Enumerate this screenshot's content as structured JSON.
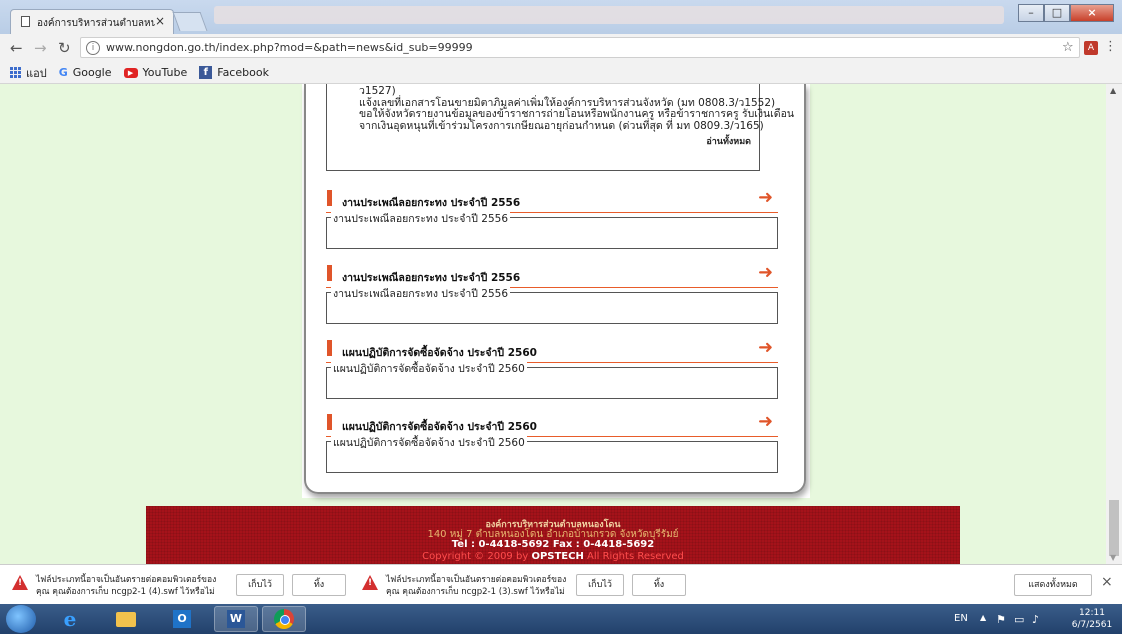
{
  "browser": {
    "tab_title": "องค์การบริหารส่วนตำบลหนอ",
    "tab_close": "×",
    "url": "www.nongdon.go.th/index.php?mod=&path=news&id_sub=99999",
    "window_buttons": [
      "–",
      "□",
      "×"
    ]
  },
  "bookmarks": [
    {
      "label": "แอป",
      "icon": "apps-icon"
    },
    {
      "label": "Google",
      "icon": "google-icon"
    },
    {
      "label": "YouTube",
      "icon": "youtube-icon"
    },
    {
      "label": "Facebook",
      "icon": "facebook-icon"
    }
  ],
  "top_list": {
    "lines": [
      "ว1527)",
      "แจ้งเลขที่เอกสารโอนขายมิตาภิมูลค่าเพิ่มให้องค์การบริหารส่วนจังหวัด (มท 0808.3/ว1552)",
      "ขอให้จังหวัดรายงานข้อมูลของข้าราชการถ่ายโอนหรือพนักงานครู หรือข้าราชการครู รับเงินเดือน",
      "จากเงินอุดหนุนที่เข้าร่วมโครงการเกษียณอายุก่อนกำหนด (ด่วนที่สุด ที่ มท 0809.3/ว165)"
    ],
    "read_all": "อ่านทั้งหมด"
  },
  "sections": [
    {
      "title": "งานประเพณีลอยกระทง ประจำปี 2556",
      "legend": "งานประเพณีลอยกระทง ประจำปี 2556"
    },
    {
      "title": "งานประเพณีลอยกระทง ประจำปี 2556",
      "legend": "งานประเพณีลอยกระทง ประจำปี 2556"
    },
    {
      "title": "แผนปฏิบัติการจัดซื้อจัดจ้าง ประจำปี 2560",
      "legend": "แผนปฏิบัติการจัดซื้อจัดจ้าง ประจำปี 2560"
    },
    {
      "title": "แผนปฏิบัติการจัดซื้อจัดจ้าง ประจำปี 2560",
      "legend": "แผนปฏิบัติการจัดซื้อจัดจ้าง ประจำปี 2560"
    }
  ],
  "footer": {
    "org_name": "องค์การบริหารส่วนตำบลหนองโดน",
    "address": "140 หมู่ 7 ตำบลหนองโดน อำเภอบ้านกรวด จังหวัดบุรีรัมย์",
    "phone_line": "Tel : 0-4418-5692  Fax : 0-4418-5692",
    "copyright_prefix": "Copyright © 2009 by",
    "copyright_company": "OPSTECH",
    "copyright_suffix": "All Rights Reserved"
  },
  "downloads": {
    "items": [
      {
        "line1": "ไฟล์ประเภทนี้อาจเป็นอันตรายต่อคอมพิวเตอร์ของ",
        "line2": "คุณ คุณต้องการเก็บ ncgp2-1 (4).swf ไว้หรือไม่",
        "keep": "เก็บไว้",
        "discard": "ทิ้ง"
      },
      {
        "line1": "ไฟล์ประเภทนี้อาจเป็นอันตรายต่อคอมพิวเตอร์ของ",
        "line2": "คุณ คุณต้องการเก็บ ncgp2-1 (3).swf ไว้หรือไม่",
        "keep": "เก็บไว้",
        "discard": "ทิ้ง"
      }
    ],
    "show_all": "แสดงทั้งหมด",
    "close": "×"
  },
  "taskbar": {
    "lang": "EN",
    "time": "12:11",
    "date": "6/7/2561"
  },
  "colors": {
    "page_bg": "#e7f8dd",
    "accent_orange": "#e0552a",
    "footer_red": "#a5121a",
    "warning_red": "#d32f2f"
  }
}
